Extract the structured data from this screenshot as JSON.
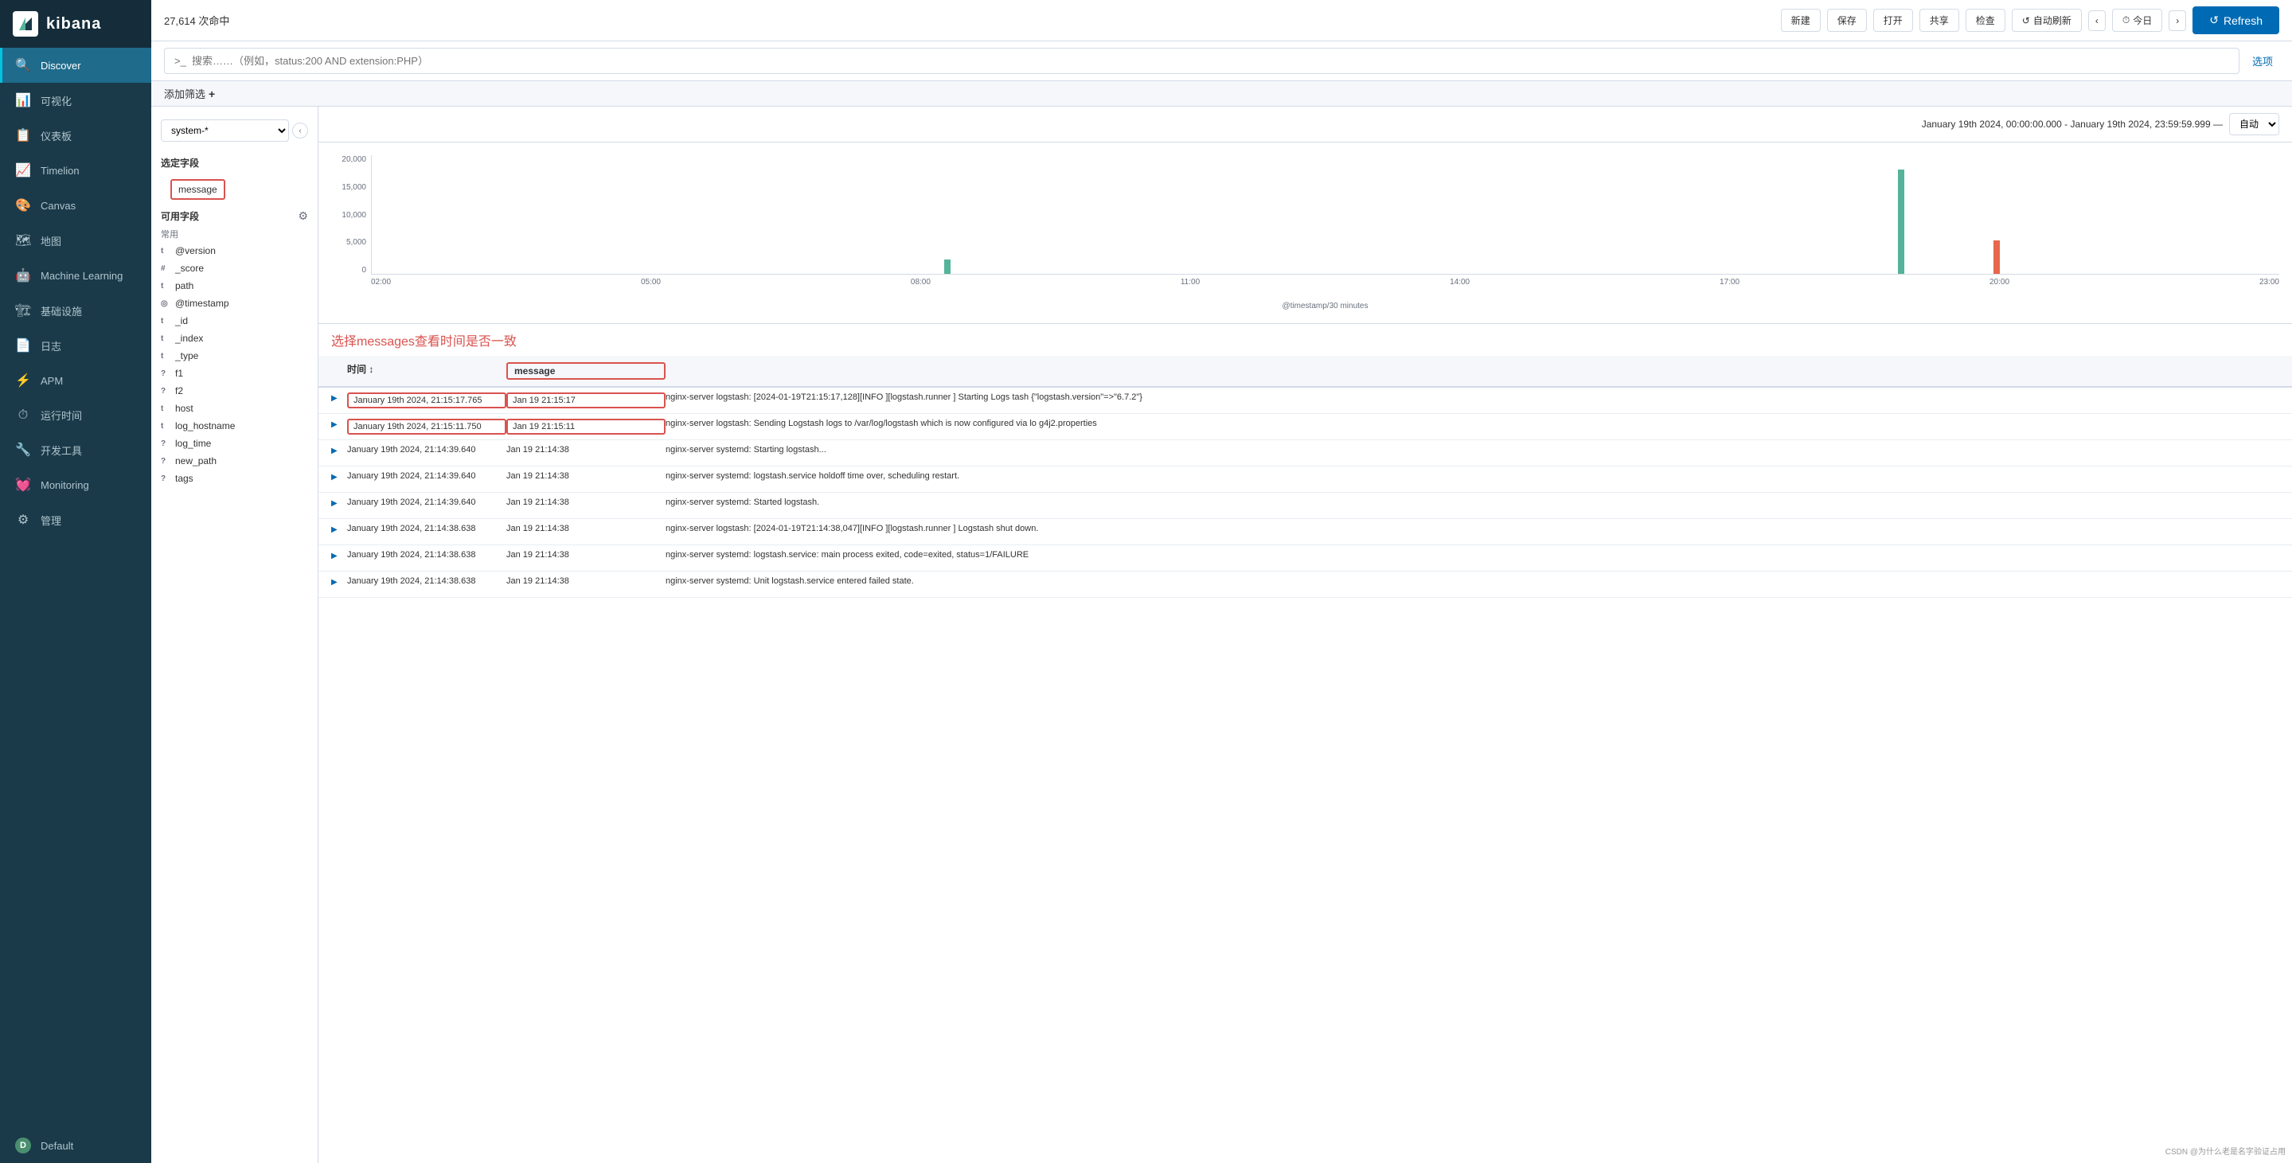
{
  "sidebar": {
    "logo_text": "kibana",
    "items": [
      {
        "id": "discover",
        "label": "Discover",
        "icon": "🔍",
        "active": true
      },
      {
        "id": "visualize",
        "label": "可视化",
        "icon": "📊"
      },
      {
        "id": "dashboard",
        "label": "仪表板",
        "icon": "📋"
      },
      {
        "id": "timelion",
        "label": "Timelion",
        "icon": "📈"
      },
      {
        "id": "canvas",
        "label": "Canvas",
        "icon": "🎨"
      },
      {
        "id": "maps",
        "label": "地图",
        "icon": "🗺"
      },
      {
        "id": "ml",
        "label": "Machine Learning",
        "icon": "🤖"
      },
      {
        "id": "infra",
        "label": "基础设施",
        "icon": "🏗"
      },
      {
        "id": "logs",
        "label": "日志",
        "icon": "📄"
      },
      {
        "id": "apm",
        "label": "APM",
        "icon": "⚡"
      },
      {
        "id": "uptime",
        "label": "运行时间",
        "icon": "⏱"
      },
      {
        "id": "devtools",
        "label": "开发工具",
        "icon": "🔧"
      },
      {
        "id": "monitoring",
        "label": "Monitoring",
        "icon": "💓"
      },
      {
        "id": "management",
        "label": "管理",
        "icon": "⚙"
      }
    ],
    "user_item": {
      "label": "Default",
      "icon": "D"
    }
  },
  "toolbar": {
    "count_label": "27,614 次命中",
    "new_label": "新建",
    "save_label": "保存",
    "open_label": "打开",
    "share_label": "共享",
    "inspect_label": "检查",
    "auto_refresh_label": "自动刷新",
    "today_label": "今日",
    "refresh_label": "Refresh"
  },
  "search": {
    "placeholder": ">_  搜索……（例如，status:200 AND extension:PHP）",
    "option_label": "选项"
  },
  "filter": {
    "add_filter_label": "添加筛选",
    "add_icon": "+"
  },
  "index": {
    "selected": "system-*"
  },
  "date_range": {
    "range_text": "January 19th 2024, 00:00:00.000 - January 19th 2024, 23:59:59.999 —",
    "auto_label": "自动"
  },
  "chart": {
    "y_axis": [
      "20,000",
      "15,000",
      "10,000",
      "5,000",
      "0"
    ],
    "x_axis": [
      "02:00",
      "05:00",
      "08:00",
      "11:00",
      "14:00",
      "17:00",
      "20:00",
      "23:00"
    ],
    "x_label": "@timestamp/30 minutes",
    "bars": [
      {
        "x_pct": 37,
        "height_pct": 12,
        "color": "green"
      },
      {
        "x_pct": 82,
        "height_pct": 88,
        "color": "green"
      },
      {
        "x_pct": 86,
        "height_pct": 28,
        "color": "pink"
      }
    ]
  },
  "annotation": {
    "text": "选择messages查看时间是否一致"
  },
  "table": {
    "headers": [
      "",
      "时间",
      "message",
      ""
    ],
    "rows": [
      {
        "highlighted": true,
        "time": "January 19th 2024, 21:15:17.765",
        "message": "Jan 19 21:15:17",
        "content": "nginx-server logstash: [2024-01-19T21:15:17,128][INFO ][logstash.runner    ] Starting Logstash {\"logstash.version\"=>\"6.7.2\"}"
      },
      {
        "highlighted": true,
        "time": "January 19th 2024, 21:15:11.750",
        "message": "Jan 19 21:15:11",
        "content": "nginx-server logstash: Sending Logstash logs to /var/log/logstash which is now configured via lo g4j2.properties"
      },
      {
        "highlighted": false,
        "time": "January 19th 2024, 21:14:39.640",
        "message": "Jan 19 21:14:38",
        "content": "nginx-server systemd: Starting logstash..."
      },
      {
        "highlighted": false,
        "time": "January 19th 2024, 21:14:39.640",
        "message": "Jan 19 21:14:38",
        "content": "nginx-server systemd: logstash.service holdoff time over, scheduling restart."
      },
      {
        "highlighted": false,
        "time": "January 19th 2024, 21:14:39.640",
        "message": "Jan 19 21:14:38",
        "content": "nginx-server systemd: Started logstash."
      },
      {
        "highlighted": false,
        "time": "January 19th 2024, 21:14:38.638",
        "message": "Jan 19 21:14:38",
        "content": "nginx-server logstash: [2024-01-19T21:14:38,047][INFO ][logstash.runner    ] Logstash shut down."
      },
      {
        "highlighted": false,
        "time": "January 19th 2024, 21:14:38.638",
        "message": "Jan 19 21:14:38",
        "content": "nginx-server systemd: logstash.service: main process exited, code=exited, status=1/FAILURE"
      },
      {
        "highlighted": false,
        "time": "January 19th 2024, 21:14:38.638",
        "message": "Jan 19 21:14:38",
        "content": "nginx-server systemd: Unit logstash.service entered failed state."
      }
    ]
  },
  "left_panel": {
    "selected_fields_title": "选定字段",
    "selected_field": "message",
    "available_fields_title": "可用字段",
    "common_label": "常用",
    "fields": [
      {
        "type": "t",
        "name": "@version"
      },
      {
        "type": "#",
        "name": "_score"
      },
      {
        "type": "t",
        "name": "path"
      },
      {
        "type": "◎",
        "name": "@timestamp"
      },
      {
        "type": "t",
        "name": "_id"
      },
      {
        "type": "t",
        "name": "_index"
      },
      {
        "type": "t",
        "name": "_type"
      },
      {
        "type": "?",
        "name": "f1"
      },
      {
        "type": "?",
        "name": "f2"
      },
      {
        "type": "t",
        "name": "host"
      },
      {
        "type": "t",
        "name": "log_hostname"
      },
      {
        "type": "?",
        "name": "log_time"
      },
      {
        "type": "?",
        "name": "new_path"
      },
      {
        "type": "?",
        "name": "tags"
      }
    ]
  },
  "watermark": "CSDN @为什么老是名字验证占用"
}
